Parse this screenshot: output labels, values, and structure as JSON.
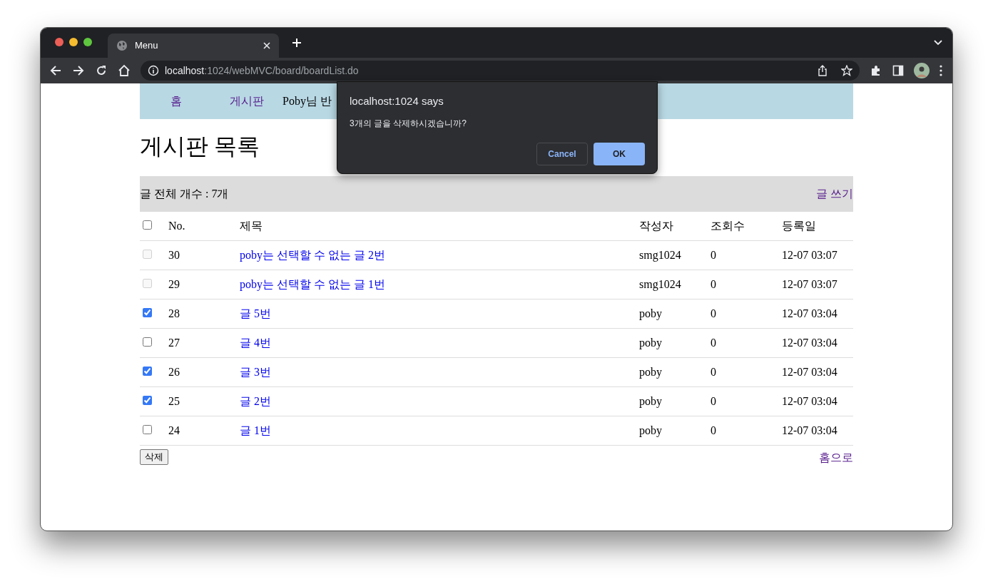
{
  "browser": {
    "tab_title": "Menu",
    "url_host": "localhost",
    "url_path": ":1024/webMVC/board/boardList.do"
  },
  "nav": {
    "items": [
      {
        "label": "홈",
        "kind": "link"
      },
      {
        "label": "게시판",
        "kind": "link"
      },
      {
        "label": "Poby님 반",
        "kind": "text"
      }
    ]
  },
  "heading": "게시판 목록",
  "summary": {
    "count_text": "글 전체 개수 : 7개",
    "write_link": "글 쓰기"
  },
  "table": {
    "select_all": {
      "checked": false
    },
    "columns": [
      "No.",
      "제목",
      "작성자",
      "조회수",
      "등록일"
    ],
    "rows": [
      {
        "checked": false,
        "disabled": true,
        "no": "30",
        "title": "poby는 선택할 수 없는 글 2번",
        "author": "smg1024",
        "views": "0",
        "date": "12-07 03:07"
      },
      {
        "checked": false,
        "disabled": true,
        "no": "29",
        "title": "poby는 선택할 수 없는 글 1번",
        "author": "smg1024",
        "views": "0",
        "date": "12-07 03:07"
      },
      {
        "checked": true,
        "disabled": false,
        "no": "28",
        "title": "글 5번",
        "author": "poby",
        "views": "0",
        "date": "12-07 03:04"
      },
      {
        "checked": false,
        "disabled": false,
        "no": "27",
        "title": "글 4번",
        "author": "poby",
        "views": "0",
        "date": "12-07 03:04"
      },
      {
        "checked": true,
        "disabled": false,
        "no": "26",
        "title": "글 3번",
        "author": "poby",
        "views": "0",
        "date": "12-07 03:04"
      },
      {
        "checked": true,
        "disabled": false,
        "no": "25",
        "title": "글 2번",
        "author": "poby",
        "views": "0",
        "date": "12-07 03:04"
      },
      {
        "checked": false,
        "disabled": false,
        "no": "24",
        "title": "글 1번",
        "author": "poby",
        "views": "0",
        "date": "12-07 03:04"
      }
    ]
  },
  "delete_button": "삭제",
  "home_link": "홈으로",
  "dialog": {
    "title": "localhost:1024 says",
    "message": "3개의 글을 삭제하시겠습니까?",
    "buttons": [
      {
        "label": "Cancel",
        "kind": "secondary"
      },
      {
        "label": "OK",
        "kind": "primary"
      }
    ]
  }
}
